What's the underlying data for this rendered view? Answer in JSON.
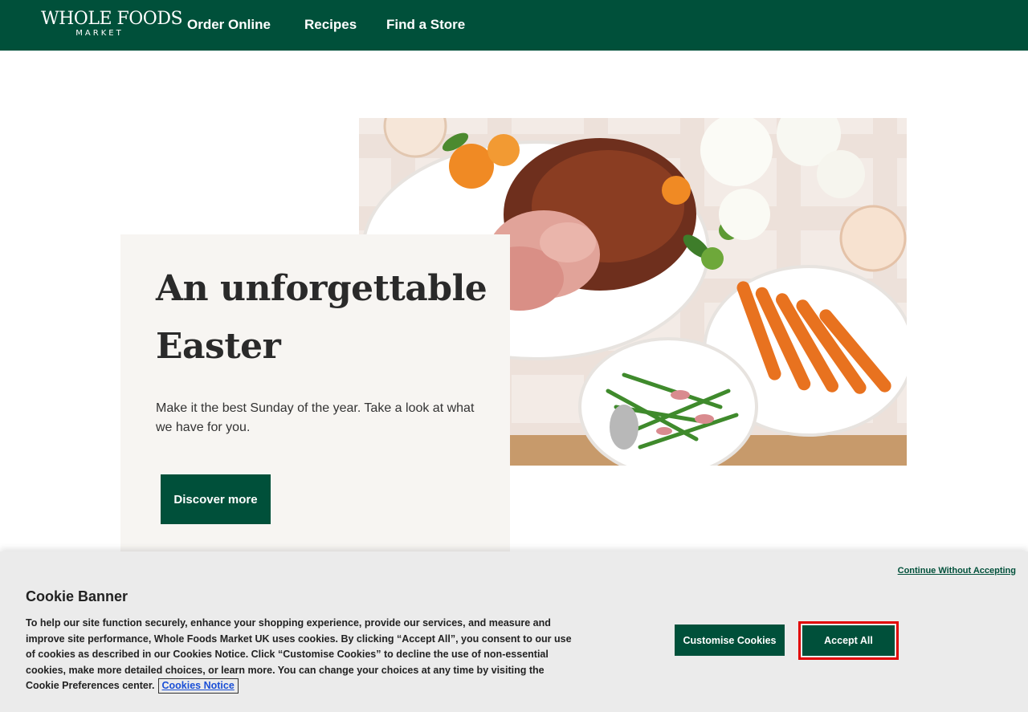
{
  "header": {
    "logo": {
      "top": "WHOLE FOODS",
      "bottom": "MARKET"
    },
    "nav": [
      {
        "label": "Order Online"
      },
      {
        "label": "Recipes"
      },
      {
        "label": "Find a Store"
      }
    ]
  },
  "hero": {
    "title": "An unforgettable Easter",
    "text": "Make it the best Sunday of the year. Take a look at what we have for you.",
    "button_label": "Discover more"
  },
  "cookie_banner": {
    "continue_label": "Continue Without Accepting",
    "title": "Cookie Banner",
    "text": "To help our site function securely, enhance your shopping experience, provide our services, and measure and improve site performance, Whole Foods Market UK uses cookies. By clicking “Accept All”, you consent to our use of cookies as described in our Cookies Notice. Click “Customise Cookies” to decline the use of non-essential cookies, make more detailed choices, or learn more. You can change your choices at any time by visiting the Cookie Preferences center.",
    "notice_link": "Cookies Notice",
    "customise_label": "Customise Cookies",
    "accept_label": "Accept All"
  },
  "colors": {
    "brand_green": "#00503a",
    "card_bg": "#f7f5f2",
    "banner_bg": "#ebebeb",
    "focus_outline": "#e10000"
  }
}
